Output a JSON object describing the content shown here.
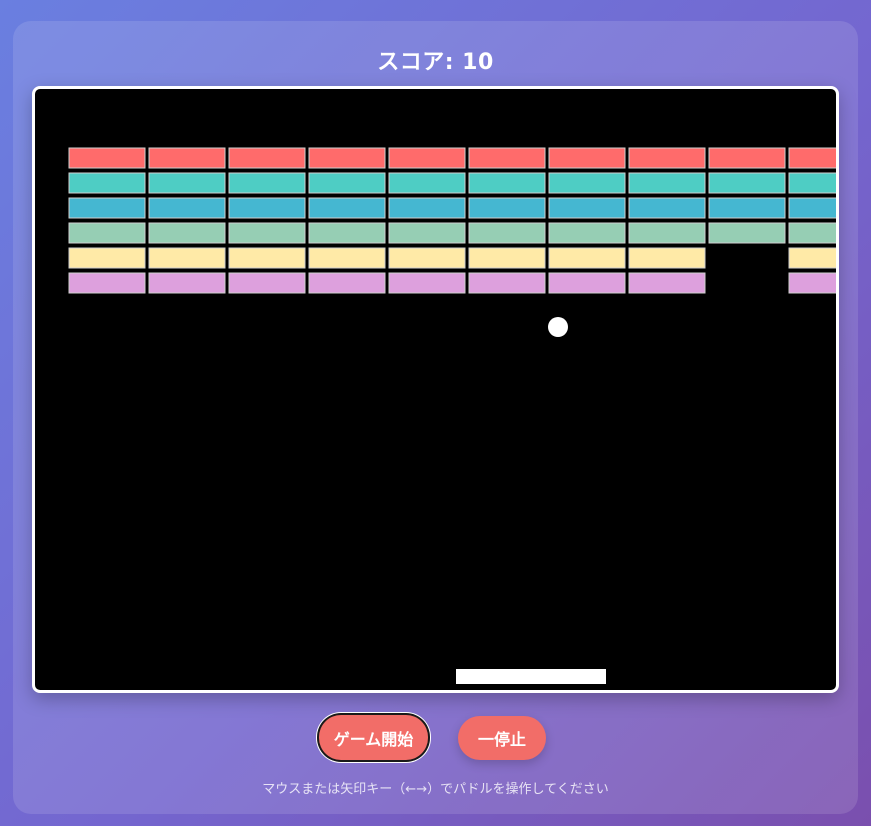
{
  "score_text": "スコア: 10",
  "buttons": {
    "start_label": "ゲーム開始",
    "pause_label": "一停止"
  },
  "hint_text": "マウスまたは矢印キー（←→）でパドルを操作してください",
  "colors": {
    "rows": [
      "#ff6b6b",
      "#4ecdc4",
      "#45b7d1",
      "#96ceb4",
      "#ffeaa7",
      "#dda0dd"
    ],
    "button": "#f26d68",
    "canvas": "#000000",
    "ball": "#ffffff",
    "paddle": "#ffffff"
  },
  "bricks": {
    "rows": 6,
    "visible_columns": 10,
    "destroyed": [
      {
        "row": 4,
        "col": 8
      },
      {
        "row": 5,
        "col": 8
      }
    ]
  }
}
